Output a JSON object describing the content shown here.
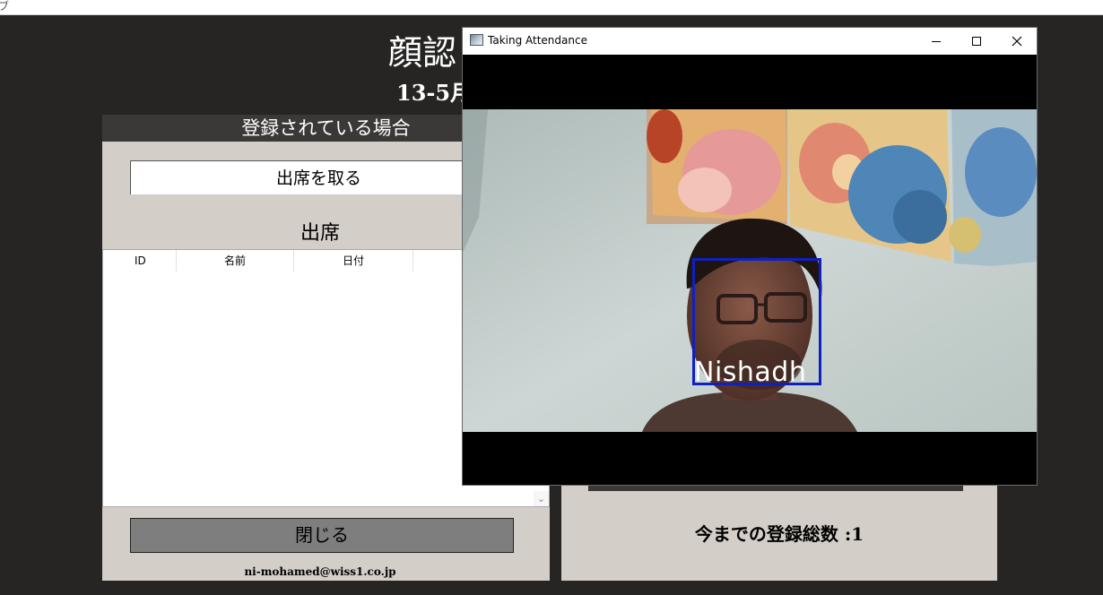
{
  "top_strip": {
    "fragment": "ブ"
  },
  "app": {
    "title": "顔認",
    "date": "13-5月"
  },
  "left_panel": {
    "header": "登録されている場合",
    "take_attendance_button": "出席を取る",
    "attendance_label": "出席",
    "table": {
      "columns": [
        "ID",
        "名前",
        "日付"
      ],
      "rows": []
    },
    "close_button": "閉じる",
    "email": "ni-mohamed@wiss1.co.jp"
  },
  "right_panel": {
    "registered_total": "今までの登録総数 :1"
  },
  "camera_window": {
    "title": "Taking Attendance",
    "detected_name": "Nishadh",
    "face_box_color": "#1020c0",
    "icons": {
      "minimize": "minimize-icon",
      "maximize": "maximize-icon",
      "close": "close-icon"
    }
  },
  "colors": {
    "background": "#262524",
    "panel": "#d4cec8",
    "header_bar": "#3a3937",
    "close_button": "#7e7e7e"
  }
}
